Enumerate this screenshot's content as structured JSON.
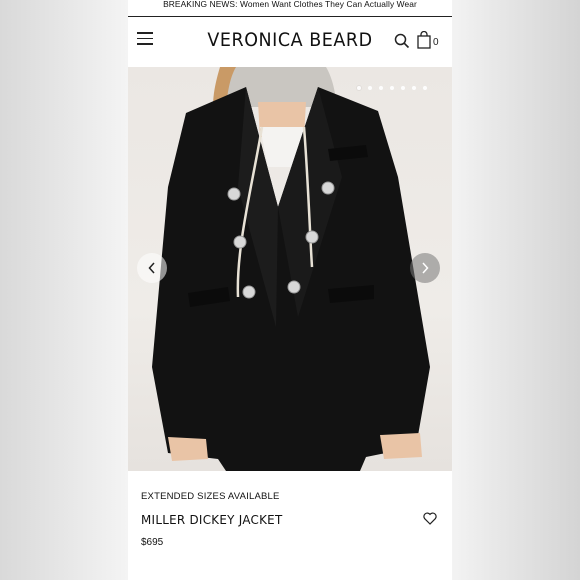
{
  "banner": {
    "text": "BREAKING NEWS: Women Want Clothes They Can Actually Wear"
  },
  "header": {
    "logo": "VERONICA BEARD",
    "menu_icon": "hamburger-icon",
    "search_icon": "search-icon",
    "bag_icon": "shopping-bag-icon",
    "bag_count": "0"
  },
  "gallery": {
    "image": "model wearing black double-breasted blazer with grey hooded dickey insert",
    "slide_count": 7,
    "active_slide": 1,
    "prev_icon": "chevron-left-icon",
    "next_icon": "chevron-right-icon"
  },
  "product": {
    "tag": "EXTENDED SIZES AVAILABLE",
    "name": "MILLER DICKEY JACKET",
    "price": "$695",
    "wishlist_icon": "heart-icon"
  },
  "colors": {
    "blazer": "#121212",
    "hood": "#c9c6c1",
    "background": "#ffffff",
    "page_sides": "#e4e4e4"
  }
}
